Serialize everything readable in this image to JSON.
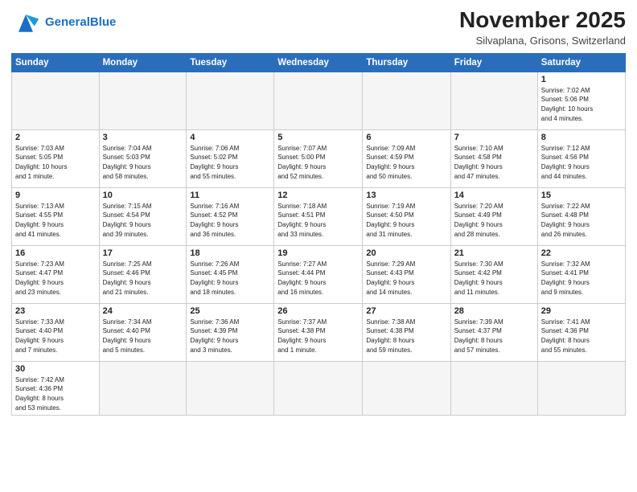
{
  "header": {
    "logo_general": "General",
    "logo_blue": "Blue",
    "month_year": "November 2025",
    "location": "Silvaplana, Grisons, Switzerland"
  },
  "days_of_week": [
    "Sunday",
    "Monday",
    "Tuesday",
    "Wednesday",
    "Thursday",
    "Friday",
    "Saturday"
  ],
  "weeks": [
    [
      {
        "day": "",
        "info": ""
      },
      {
        "day": "",
        "info": ""
      },
      {
        "day": "",
        "info": ""
      },
      {
        "day": "",
        "info": ""
      },
      {
        "day": "",
        "info": ""
      },
      {
        "day": "",
        "info": ""
      },
      {
        "day": "1",
        "info": "Sunrise: 7:02 AM\nSunset: 5:06 PM\nDaylight: 10 hours\nand 4 minutes."
      }
    ],
    [
      {
        "day": "2",
        "info": "Sunrise: 7:03 AM\nSunset: 5:05 PM\nDaylight: 10 hours\nand 1 minute."
      },
      {
        "day": "3",
        "info": "Sunrise: 7:04 AM\nSunset: 5:03 PM\nDaylight: 9 hours\nand 58 minutes."
      },
      {
        "day": "4",
        "info": "Sunrise: 7:06 AM\nSunset: 5:02 PM\nDaylight: 9 hours\nand 55 minutes."
      },
      {
        "day": "5",
        "info": "Sunrise: 7:07 AM\nSunset: 5:00 PM\nDaylight: 9 hours\nand 52 minutes."
      },
      {
        "day": "6",
        "info": "Sunrise: 7:09 AM\nSunset: 4:59 PM\nDaylight: 9 hours\nand 50 minutes."
      },
      {
        "day": "7",
        "info": "Sunrise: 7:10 AM\nSunset: 4:58 PM\nDaylight: 9 hours\nand 47 minutes."
      },
      {
        "day": "8",
        "info": "Sunrise: 7:12 AM\nSunset: 4:56 PM\nDaylight: 9 hours\nand 44 minutes."
      }
    ],
    [
      {
        "day": "9",
        "info": "Sunrise: 7:13 AM\nSunset: 4:55 PM\nDaylight: 9 hours\nand 41 minutes."
      },
      {
        "day": "10",
        "info": "Sunrise: 7:15 AM\nSunset: 4:54 PM\nDaylight: 9 hours\nand 39 minutes."
      },
      {
        "day": "11",
        "info": "Sunrise: 7:16 AM\nSunset: 4:52 PM\nDaylight: 9 hours\nand 36 minutes."
      },
      {
        "day": "12",
        "info": "Sunrise: 7:18 AM\nSunset: 4:51 PM\nDaylight: 9 hours\nand 33 minutes."
      },
      {
        "day": "13",
        "info": "Sunrise: 7:19 AM\nSunset: 4:50 PM\nDaylight: 9 hours\nand 31 minutes."
      },
      {
        "day": "14",
        "info": "Sunrise: 7:20 AM\nSunset: 4:49 PM\nDaylight: 9 hours\nand 28 minutes."
      },
      {
        "day": "15",
        "info": "Sunrise: 7:22 AM\nSunset: 4:48 PM\nDaylight: 9 hours\nand 26 minutes."
      }
    ],
    [
      {
        "day": "16",
        "info": "Sunrise: 7:23 AM\nSunset: 4:47 PM\nDaylight: 9 hours\nand 23 minutes."
      },
      {
        "day": "17",
        "info": "Sunrise: 7:25 AM\nSunset: 4:46 PM\nDaylight: 9 hours\nand 21 minutes."
      },
      {
        "day": "18",
        "info": "Sunrise: 7:26 AM\nSunset: 4:45 PM\nDaylight: 9 hours\nand 18 minutes."
      },
      {
        "day": "19",
        "info": "Sunrise: 7:27 AM\nSunset: 4:44 PM\nDaylight: 9 hours\nand 16 minutes."
      },
      {
        "day": "20",
        "info": "Sunrise: 7:29 AM\nSunset: 4:43 PM\nDaylight: 9 hours\nand 14 minutes."
      },
      {
        "day": "21",
        "info": "Sunrise: 7:30 AM\nSunset: 4:42 PM\nDaylight: 9 hours\nand 11 minutes."
      },
      {
        "day": "22",
        "info": "Sunrise: 7:32 AM\nSunset: 4:41 PM\nDaylight: 9 hours\nand 9 minutes."
      }
    ],
    [
      {
        "day": "23",
        "info": "Sunrise: 7:33 AM\nSunset: 4:40 PM\nDaylight: 9 hours\nand 7 minutes."
      },
      {
        "day": "24",
        "info": "Sunrise: 7:34 AM\nSunset: 4:40 PM\nDaylight: 9 hours\nand 5 minutes."
      },
      {
        "day": "25",
        "info": "Sunrise: 7:36 AM\nSunset: 4:39 PM\nDaylight: 9 hours\nand 3 minutes."
      },
      {
        "day": "26",
        "info": "Sunrise: 7:37 AM\nSunset: 4:38 PM\nDaylight: 9 hours\nand 1 minute."
      },
      {
        "day": "27",
        "info": "Sunrise: 7:38 AM\nSunset: 4:38 PM\nDaylight: 8 hours\nand 59 minutes."
      },
      {
        "day": "28",
        "info": "Sunrise: 7:39 AM\nSunset: 4:37 PM\nDaylight: 8 hours\nand 57 minutes."
      },
      {
        "day": "29",
        "info": "Sunrise: 7:41 AM\nSunset: 4:36 PM\nDaylight: 8 hours\nand 55 minutes."
      }
    ],
    [
      {
        "day": "30",
        "info": "Sunrise: 7:42 AM\nSunset: 4:36 PM\nDaylight: 8 hours\nand 53 minutes."
      },
      {
        "day": "",
        "info": ""
      },
      {
        "day": "",
        "info": ""
      },
      {
        "day": "",
        "info": ""
      },
      {
        "day": "",
        "info": ""
      },
      {
        "day": "",
        "info": ""
      },
      {
        "day": "",
        "info": ""
      }
    ]
  ]
}
